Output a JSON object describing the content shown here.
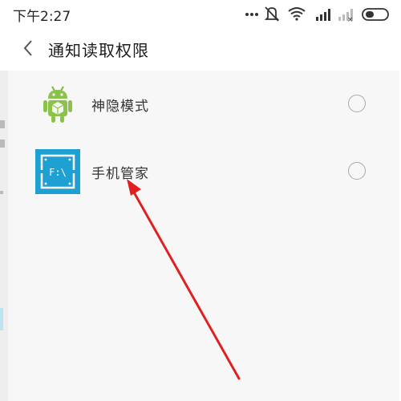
{
  "status_bar": {
    "time": "下午2:27",
    "icons": [
      "more-dots-icon",
      "mute-icon",
      "wifi-icon",
      "signal-icon",
      "signal-no-service-icon",
      "battery-icon"
    ]
  },
  "header": {
    "title": "通知读取权限",
    "back_icon": "chevron-left-icon"
  },
  "apps": [
    {
      "label": "神隐模式",
      "icon": "android-robot-icon",
      "selected": false
    },
    {
      "label": "手机管家",
      "icon": "file-manager-icon",
      "icon_text": "F:\\",
      "selected": false
    }
  ],
  "colors": {
    "panel_background": "#f7f7f7",
    "android_green": "#8bc34a",
    "file_icon_blue": "#1ea0d3",
    "annotation_red": "#e02020"
  }
}
